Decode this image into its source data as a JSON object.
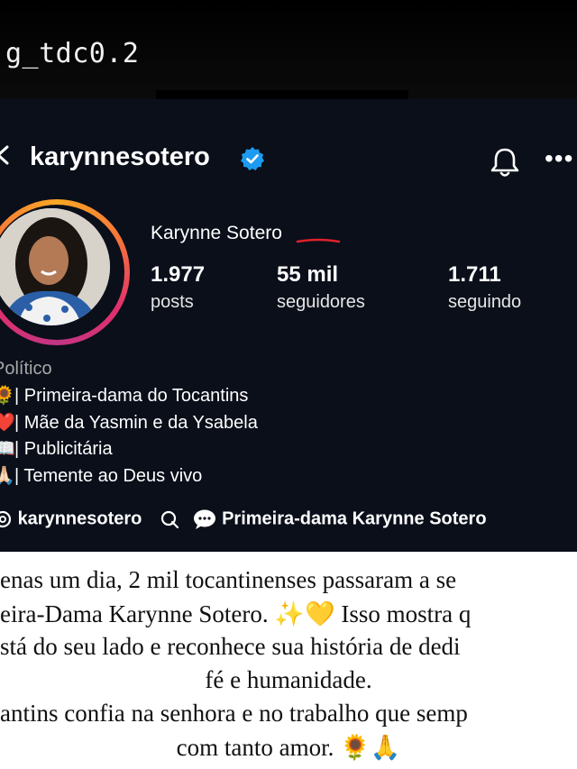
{
  "story": {
    "title": "g_tdc0.2"
  },
  "profile": {
    "username": "karynnesotero",
    "full_name": "Karynne Sotero",
    "category": "Político",
    "stats": [
      {
        "value": "1.977",
        "label": "posts"
      },
      {
        "value": "55 mil",
        "label": "seguidores"
      },
      {
        "value": "1.711",
        "label": "seguindo"
      }
    ],
    "bio": [
      {
        "emoji": "🌻",
        "text": "| Primeira-dama do Tocantins"
      },
      {
        "emoji": "❤️",
        "text": "| Mãe da Yasmin e da Ysabela"
      },
      {
        "emoji": "📖",
        "text": "| Publicitária"
      },
      {
        "emoji": "🙏🏻",
        "text": "| Temente ao Deus vivo"
      }
    ],
    "threads_handle": "karynnesotero",
    "channel": "Primeira-dama Karynne Sotero"
  },
  "caption": {
    "lines": [
      "enas um dia, 2 mil tocantinenses passaram a se",
      "eira-Dama Karynne Sotero. ✨💛 Isso mostra q",
      "stá do seu lado e reconhece sua história de dedi",
      "fé e humanidade.",
      "antins confia na senhora e no trabalho que semp",
      "com tanto amor. 🌻🙏"
    ]
  },
  "colors": {
    "verified": "#1d9bf0",
    "annotation": "#e0202a",
    "ig_bg": "#0a0f1a"
  }
}
